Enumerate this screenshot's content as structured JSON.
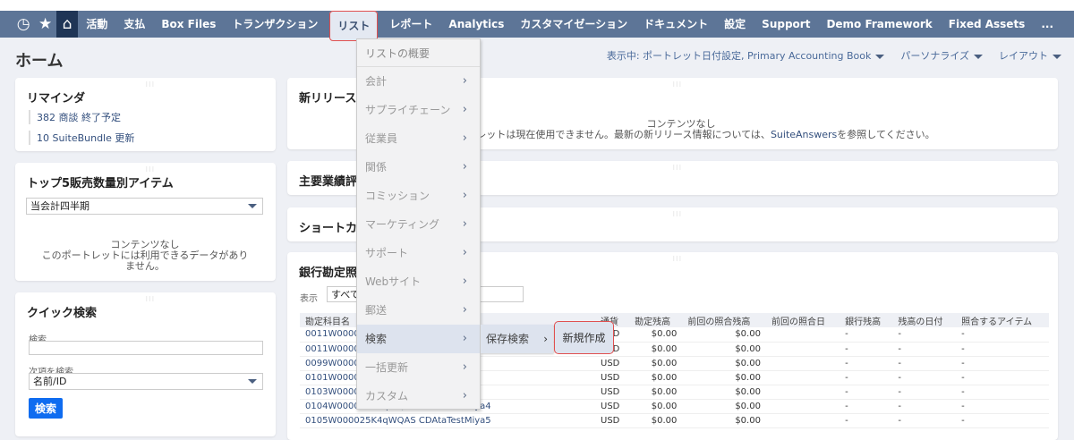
{
  "nav": {
    "items": [
      "活動",
      "支払",
      "Box Files",
      "トランザクション",
      "リスト",
      "レポート",
      "Analytics",
      "カスタマイゼーション",
      "ドキュメント",
      "設定",
      "Support",
      "Demo Framework",
      "Fixed Assets"
    ],
    "more": "..."
  },
  "page": {
    "title": "ホーム",
    "viewing": "表示中: ポートレット日付設定, Primary Accounting Book",
    "personalize": "パーソナライズ",
    "layout": "レイアウト"
  },
  "reminders": {
    "title": "リマインダ",
    "items": [
      "382 商談 終了予定",
      "10 SuiteBundle 更新"
    ]
  },
  "top5": {
    "title": "トップ5販売数量別アイテム",
    "period": "当会計四半期",
    "empty_title": "コンテンツなし",
    "empty_msg": "このポートレットには利用できるデータがありません。"
  },
  "quick": {
    "title": "クイック検索",
    "search_label": "検索",
    "search_value": "",
    "by_label": "次項を検索",
    "by_value": "名前/ID",
    "button": "検索"
  },
  "release": {
    "title": "新リリース",
    "empty_title": "コンテンツなし",
    "msg_pre": "このポートレットは現在使用できません。最新の新リリース情報については、",
    "link": "SuiteAnswers",
    "msg_post": "を参照してください。"
  },
  "kpi": {
    "title": "主要業績評価指標"
  },
  "shortcut": {
    "title": "ショートカット"
  },
  "bank": {
    "title": "銀行勘定照合",
    "show_label": "表示",
    "show_value": "すべて",
    "columns": [
      "勘定科目名",
      "通貨",
      "勘定残高",
      "前回の照合残高",
      "前回の照合日",
      "銀行残高",
      "残高の日付",
      "照合するアイテム"
    ],
    "rows": [
      [
        "0011W00001ze",
        "USD",
        "$0.00",
        "$0.00",
        "",
        "-",
        "-",
        "-"
      ],
      [
        "0011W000025K",
        "USD",
        "$0.00",
        "$0.00",
        "",
        "-",
        "-",
        "-"
      ],
      [
        "0099W000025K",
        "USD",
        "$0.00",
        "$0.00",
        "",
        "-",
        "-",
        "-"
      ],
      [
        "0101W000025K",
        "USD",
        "$0.00",
        "$0.00",
        "",
        "-",
        "-",
        "-"
      ],
      [
        "0103W000025K",
        "USD",
        "$0.00",
        "$0.00",
        "",
        "-",
        "-",
        "-"
      ],
      [
        "0104W000025K4qWQAS CDAtaTestMiya4",
        "USD",
        "$0.00",
        "$0.00",
        "",
        "-",
        "-",
        "-"
      ],
      [
        "0105W000025K4qWQAS CDAtaTestMiya5",
        "USD",
        "$0.00",
        "$0.00",
        "",
        "-",
        "-",
        "-"
      ]
    ]
  },
  "menu": {
    "overview": "リストの概要",
    "items": [
      "会計",
      "サプライチェーン",
      "従業員",
      "関係",
      "コミッション",
      "マーケティング",
      "サポート",
      "Webサイト",
      "郵送",
      "検索",
      "一括更新",
      "カスタム"
    ],
    "sub": "保存検索",
    "sub2": "新規作成"
  }
}
